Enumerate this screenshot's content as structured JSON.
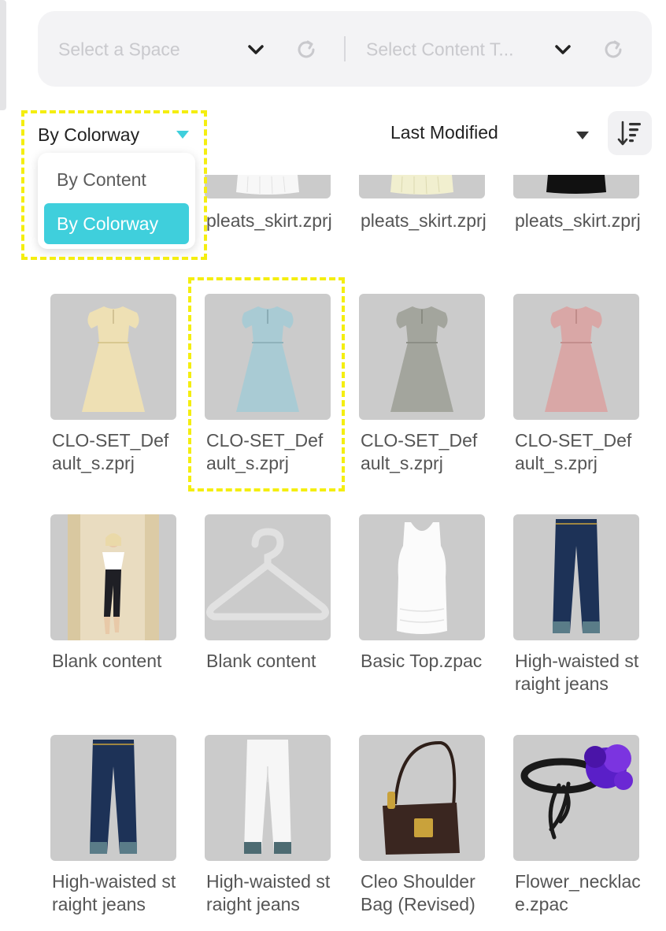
{
  "filters": {
    "space_placeholder": "Select a Space",
    "content_type_placeholder": "Select Content T..."
  },
  "grouping": {
    "selected": "By Colorway",
    "options": [
      "By Content",
      "By Colorway"
    ]
  },
  "sort": {
    "selected": "Last Modified"
  },
  "colors": {
    "accent": "#3fcfdc",
    "highlight": "#f4ee10",
    "thumb_bg": "#cbcbcb"
  },
  "partial_row": [
    {
      "name": "pleats_skirt.zprj",
      "thumb": "white-skirt"
    },
    {
      "name": "pleats_skirt.zprj",
      "thumb": "cream-skirt"
    },
    {
      "name": "pleats_skirt.zprj",
      "thumb": "black-skirt"
    }
  ],
  "items": [
    {
      "name": "CLO-SET_Default_s.zprj",
      "thumb": "dress-yellow"
    },
    {
      "name": "CLO-SET_Default_s.zprj",
      "thumb": "dress-blue"
    },
    {
      "name": "CLO-SET_Default_s.zprj",
      "thumb": "dress-gray"
    },
    {
      "name": "CLO-SET_Default_s.zprj",
      "thumb": "dress-pink"
    },
    {
      "name": "Blank content",
      "thumb": "photo-model"
    },
    {
      "name": "Blank content",
      "thumb": "hanger-icon"
    },
    {
      "name": "Basic Top.zpac",
      "thumb": "tank-top"
    },
    {
      "name": "High-waisted straight jeans",
      "thumb": "jeans-navy"
    },
    {
      "name": "High-waisted straight jeans",
      "thumb": "jeans-navy"
    },
    {
      "name": "High-waisted straight jeans",
      "thumb": "jeans-white"
    },
    {
      "name": "Cleo Shoulder Bag (Revised)",
      "thumb": "shoulder-bag"
    },
    {
      "name": "Flower_necklace.zpac",
      "thumb": "flower-necklace"
    }
  ]
}
